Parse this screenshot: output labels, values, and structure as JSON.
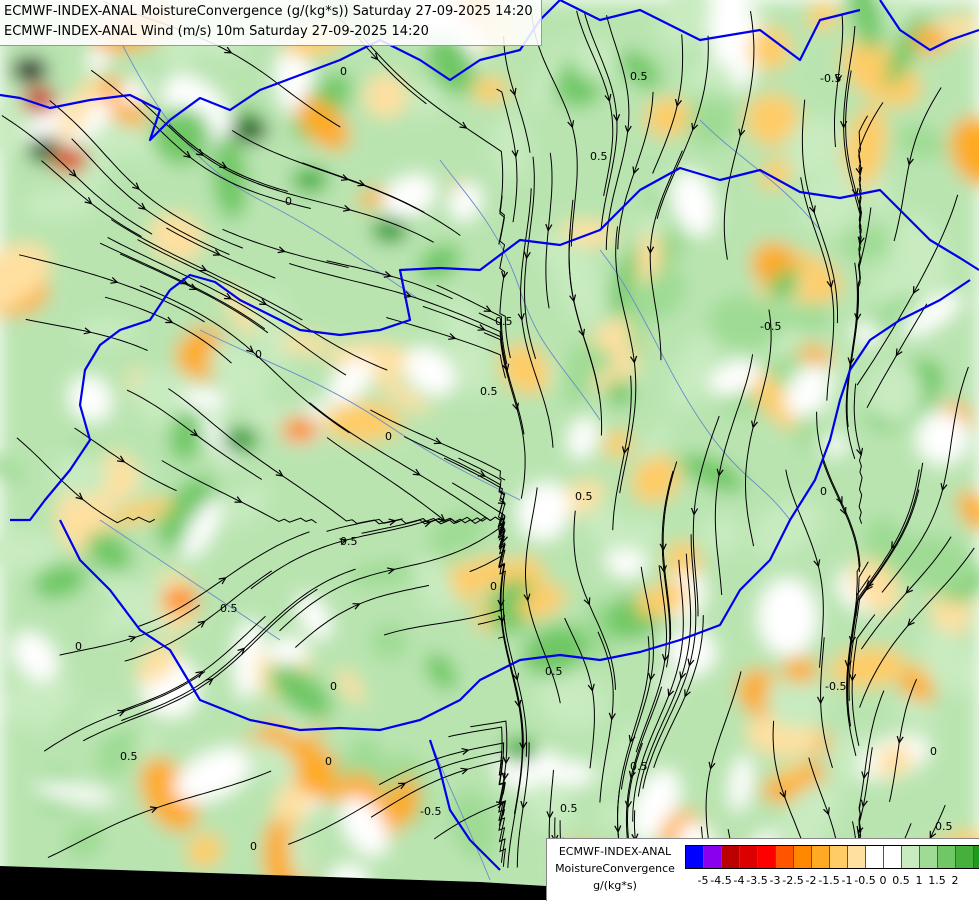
{
  "header": {
    "line1": "ECMWF-INDEX-ANAL MoistureConvergence (g/(kg*s)) Saturday 27-09-2025 14:20",
    "line2": "ECMWF-INDEX-ANAL Wind (m/s) 10m Saturday 27-09-2025 14:20"
  },
  "legend": {
    "model": "ECMWF-INDEX-ANAL",
    "variable": "MoistureConvergence",
    "unit": "g/(kg*s)",
    "colors": [
      "#0000ff",
      "#8800ee",
      "#bb0000",
      "#dd0000",
      "#ff0000",
      "#ff5500",
      "#ff8800",
      "#ffaa22",
      "#ffcc66",
      "#ffe0a0",
      "#ffffff",
      "#ffffff",
      "#c8ebc0",
      "#9fdb94",
      "#6fc865",
      "#45b03c",
      "#1e9a1e"
    ],
    "ticks": [
      "-5",
      "-4.5",
      "-4",
      "-3.5",
      "-3",
      "-2.5",
      "-2",
      "-1.5",
      "-1",
      "-0.5",
      "0",
      "0.5",
      "1",
      "1.5",
      "2"
    ]
  },
  "contour_labels": [
    "0",
    "0.5",
    "-0.5",
    "0.5",
    "0",
    "0.5",
    "0",
    "0.5",
    "-0.5",
    "0",
    "0.5",
    "0",
    "0.5",
    "0",
    "0.5",
    "0",
    "0",
    "0.5",
    "-0.5",
    "0.5",
    "0",
    "0.5",
    "0",
    "-0.5",
    "0.5",
    "0",
    "0.5"
  ],
  "colors": {
    "border": "#0000ee",
    "river": "#6a8cc8",
    "streamline": "#000000",
    "sea": "#000000"
  }
}
